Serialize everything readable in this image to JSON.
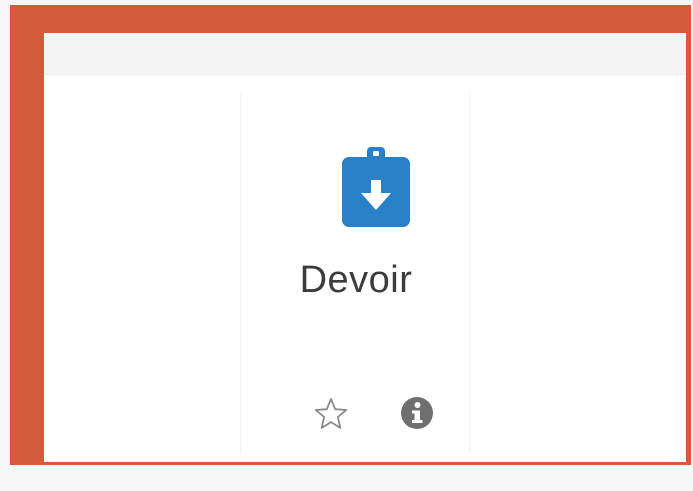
{
  "activity": {
    "name": "Devoir",
    "icon": "assignment-icon",
    "accent_color": "#2a80c7"
  },
  "actions": {
    "star": {
      "icon": "star-outline-icon"
    },
    "info": {
      "icon": "info-circle-icon"
    }
  },
  "highlight": {
    "color": "#d35a3a"
  }
}
